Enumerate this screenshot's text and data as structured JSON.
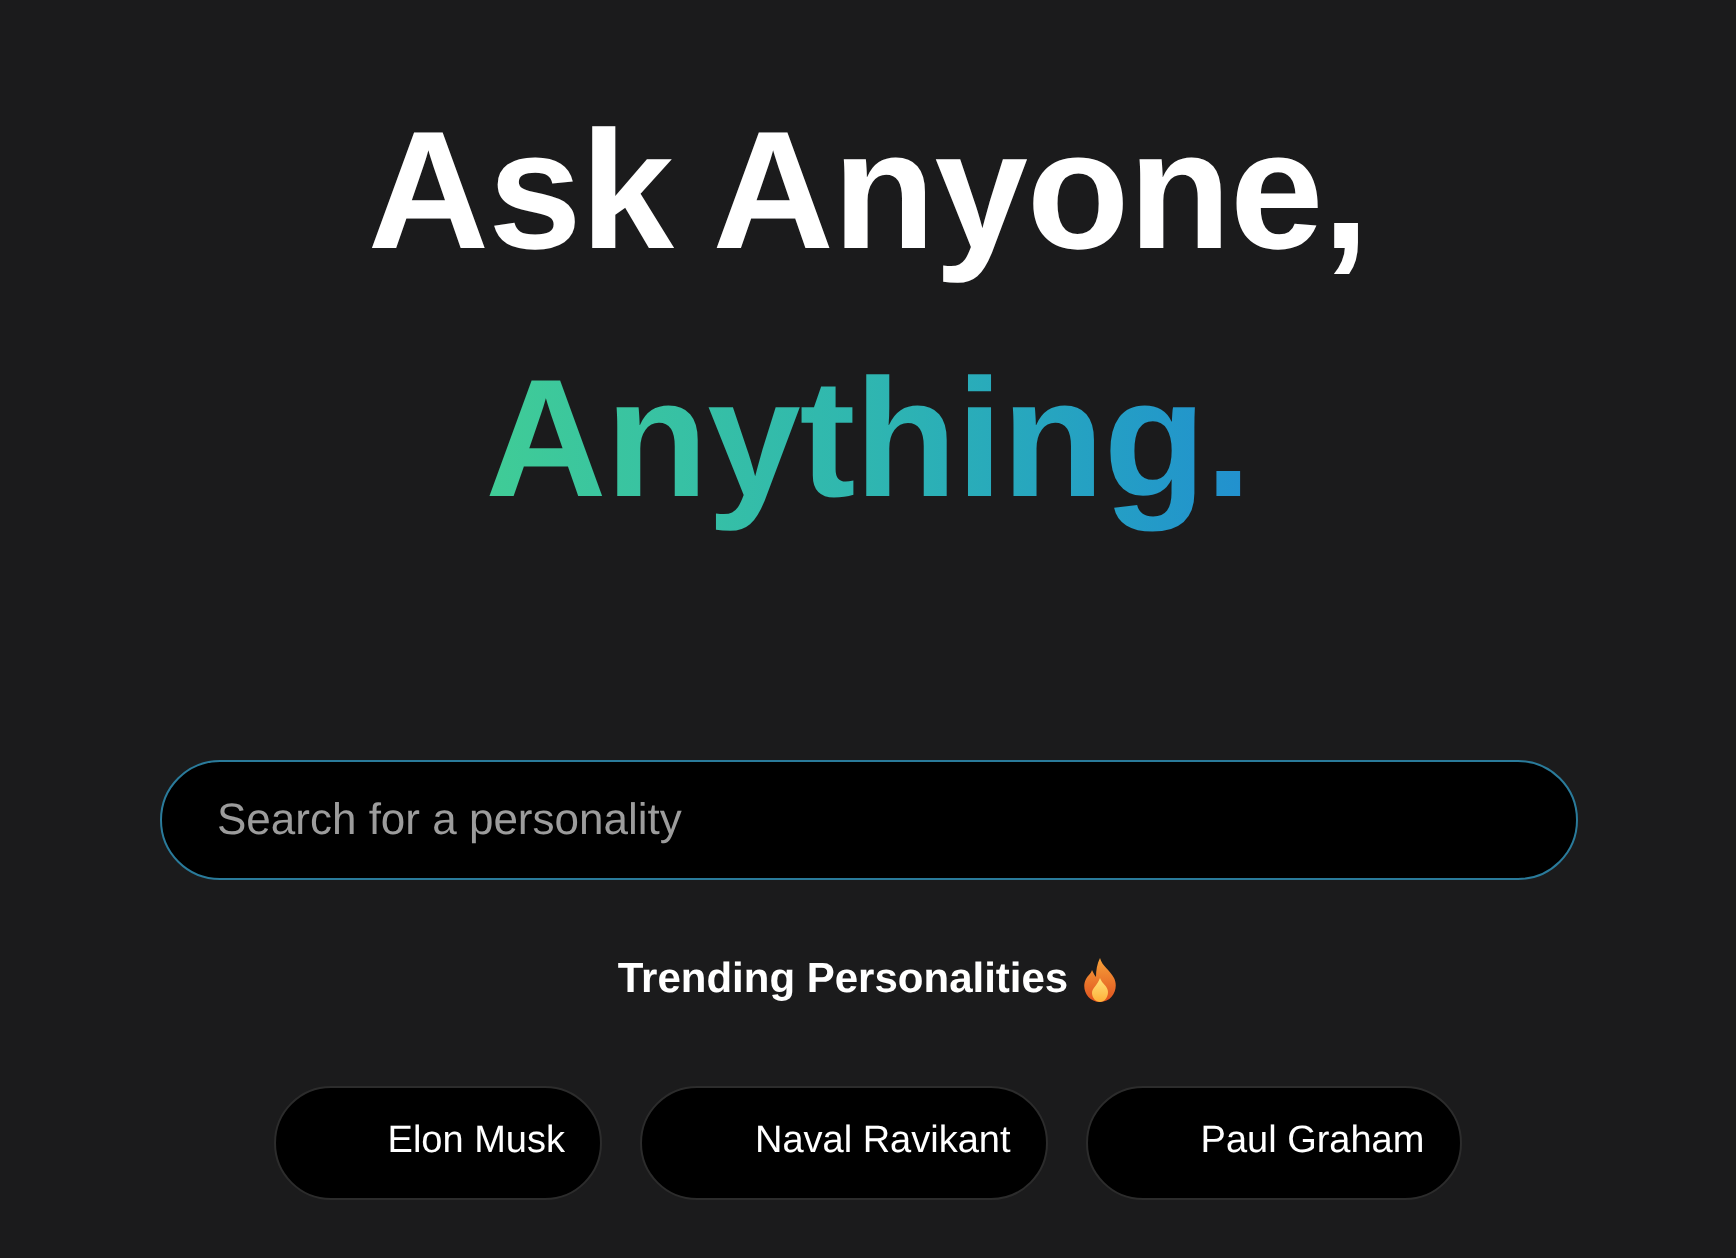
{
  "heading": {
    "line_1": "Ask Anyone,",
    "line_2": "Anything."
  },
  "search": {
    "placeholder": "Search for a personality"
  },
  "trending": {
    "title": "Trending Personalities",
    "personalities": [
      {
        "name": "Elon Musk"
      },
      {
        "name": "Naval Ravikant"
      },
      {
        "name": "Paul Graham"
      }
    ]
  }
}
